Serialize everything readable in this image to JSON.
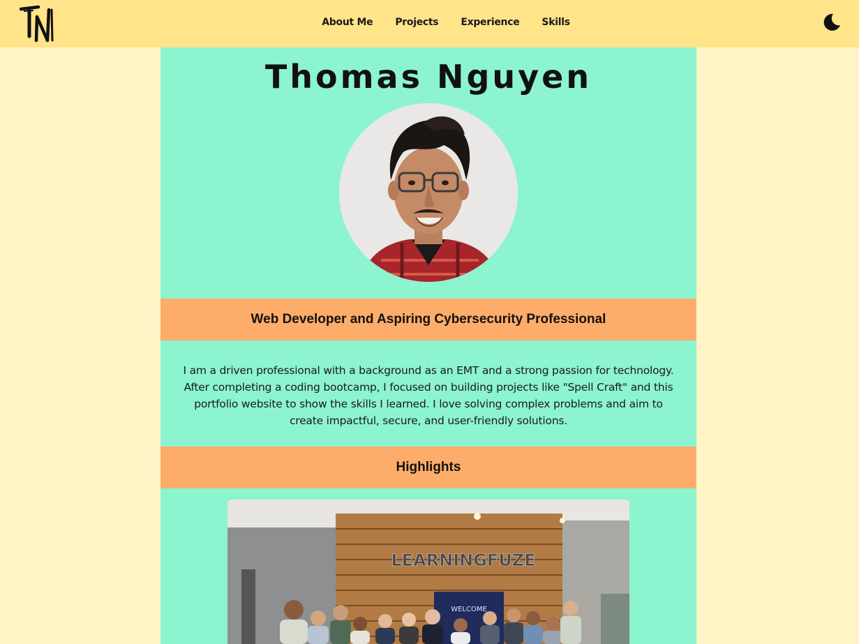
{
  "logo": {
    "text": "TN"
  },
  "nav": {
    "links": [
      "About Me",
      "Projects",
      "Experience",
      "Skills"
    ],
    "theme_icon": "moon-icon"
  },
  "hero": {
    "name": "Thomas Nguyen",
    "avatar_alt": "profile-photo"
  },
  "about": {
    "heading": "Web Developer and Aspiring Cybersecurity Professional",
    "body": "I am a driven professional with a background as an EMT and a strong passion for technology. After completing a coding bootcamp, I focused on building projects like \"Spell Craft\" and this portfolio website to show the skills I learned. I love solving complex problems and aim to create impactful, secure, and user-friendly solutions."
  },
  "highlights": {
    "heading": "Highlights",
    "photo_sign_text": "LEARNINGFUZE",
    "photo_screen_text": "WELCOME"
  },
  "colors": {
    "page_bg": "#fff4c6",
    "nav_bg": "#ffe48a",
    "column_bg": "#8cf4ce",
    "band_bg": "#fdac6a"
  }
}
